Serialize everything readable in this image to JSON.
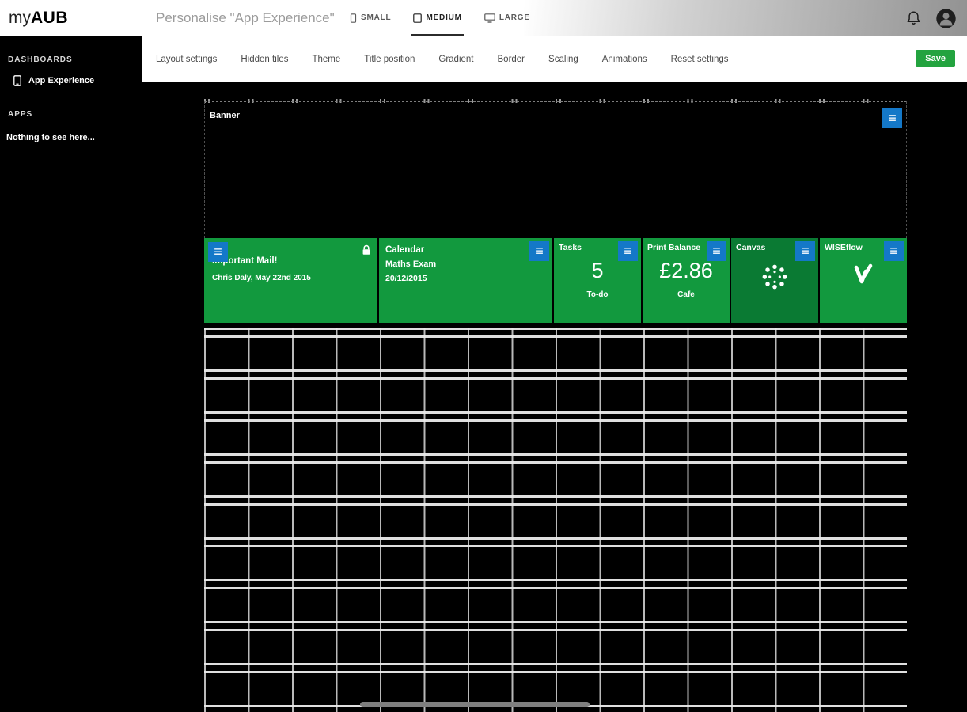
{
  "logo": {
    "prefix": "my",
    "name": "AUB"
  },
  "header": {
    "title": "Personalise \"App Experience\"",
    "sizes": [
      {
        "label": "SMALL"
      },
      {
        "label": "MEDIUM"
      },
      {
        "label": "LARGE"
      }
    ]
  },
  "toolbar": {
    "items": [
      "Layout settings",
      "Hidden tiles",
      "Theme",
      "Title position",
      "Gradient",
      "Border",
      "Scaling",
      "Animations",
      "Reset settings"
    ],
    "save": "Save"
  },
  "sidebar": {
    "dashboards_heading": "DASHBOARDS",
    "dashboard_item": "App Experience",
    "apps_heading": "APPS",
    "apps_empty": "Nothing to see here..."
  },
  "board": {
    "banner_label": "Banner",
    "tiles": {
      "mail": {
        "title": "Important Mail!",
        "subtitle": "Chris Daly, May 22nd 2015"
      },
      "calendar": {
        "title": "Calendar",
        "line2": "Maths Exam",
        "line3": "20/12/2015"
      },
      "tasks": {
        "title": "Tasks",
        "value": "5",
        "caption": "To-do"
      },
      "print": {
        "title": "Print Balance",
        "value": "£2.86",
        "caption": "Cafe"
      },
      "canvas": {
        "title": "Canvas"
      },
      "wiseflow": {
        "title": "WISEflow"
      }
    }
  },
  "icons": {
    "menu": "≡"
  },
  "colors": {
    "tile_green": "#12993E",
    "tile_green_dark": "#0A7A33",
    "menu_blue": "#1478C8",
    "save_green": "#23A33F"
  }
}
